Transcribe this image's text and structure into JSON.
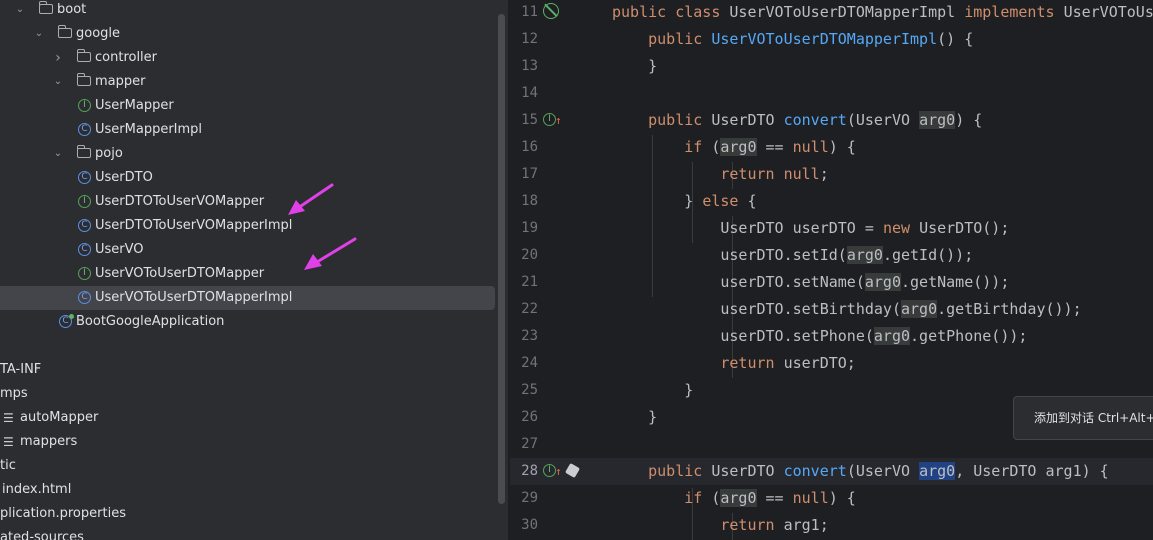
{
  "project_tree": {
    "rows": [
      {
        "label": "boot",
        "kind": "folder",
        "indent": 1,
        "expanded": true
      },
      {
        "label": "google",
        "kind": "folder",
        "indent": 2,
        "expanded": true
      },
      {
        "label": "controller",
        "kind": "folder",
        "indent": 3,
        "expanded": false
      },
      {
        "label": "mapper",
        "kind": "folder",
        "indent": 3,
        "expanded": true
      },
      {
        "label": "UserMapper",
        "kind": "interface",
        "indent": 4
      },
      {
        "label": "UserMapperImpl",
        "kind": "class",
        "indent": 4
      },
      {
        "label": "pojo",
        "kind": "folder",
        "indent": 3,
        "expanded": true
      },
      {
        "label": "UserDTO",
        "kind": "class",
        "indent": 4
      },
      {
        "label": "UserDTOToUserVOMapper",
        "kind": "interface",
        "indent": 4
      },
      {
        "label": "UserDTOToUserVOMapperImpl",
        "kind": "class",
        "indent": 4
      },
      {
        "label": "UserVO",
        "kind": "class",
        "indent": 4
      },
      {
        "label": "UserVOToUserDTOMapper",
        "kind": "interface",
        "indent": 4
      },
      {
        "label": "UserVOToUserDTOMapperImpl",
        "kind": "class",
        "indent": 4,
        "selected": true
      },
      {
        "label": "BootGoogleApplication",
        "kind": "app",
        "indent": 3
      },
      {
        "label": "",
        "kind": "spacer"
      },
      {
        "label": "TA-INF",
        "kind": "plain",
        "indent": 0
      },
      {
        "label": "mps",
        "kind": "plain",
        "indent": 0
      },
      {
        "label": "autoMapper",
        "kind": "lines",
        "indent": 0
      },
      {
        "label": "mappers",
        "kind": "lines",
        "indent": 0
      },
      {
        "label": "tic",
        "kind": "plain",
        "indent": 0
      },
      {
        "label": "index.html",
        "kind": "plain2",
        "indent": 0
      },
      {
        "label": "plication.properties",
        "kind": "plain",
        "indent": 0
      },
      {
        "label": "ated-sources",
        "kind": "plain",
        "indent": 0
      }
    ]
  },
  "editor": {
    "lines": [
      {
        "num": "11",
        "gutter": "bean",
        "tokens": [
          [
            "k",
            "public class "
          ],
          [
            "p",
            "UserVOToUserDTOMapperImpl "
          ],
          [
            "k",
            "implements "
          ],
          [
            "p",
            "UserVOToUserDTOMapper"
          ]
        ]
      },
      {
        "num": "12",
        "tokens": [
          [
            "p",
            "    "
          ],
          [
            "k",
            "public "
          ],
          [
            "f",
            "UserVOToUserDTOMapperImpl"
          ],
          [
            "p",
            "() {"
          ]
        ]
      },
      {
        "num": "13",
        "tokens": [
          [
            "p",
            "    }"
          ]
        ]
      },
      {
        "num": "14",
        "tokens": []
      },
      {
        "num": "15",
        "gutter": "impl",
        "tokens": [
          [
            "p",
            "    "
          ],
          [
            "k",
            "public "
          ],
          [
            "p",
            "UserDTO "
          ],
          [
            "f",
            "convert"
          ],
          [
            "p",
            "(UserVO "
          ],
          [
            "h",
            "arg0"
          ],
          [
            "p",
            ") {"
          ]
        ]
      },
      {
        "num": "16",
        "tokens": [
          [
            "p",
            "        "
          ],
          [
            "k",
            "if "
          ],
          [
            "p",
            "("
          ],
          [
            "h",
            "arg0"
          ],
          [
            "p",
            " == "
          ],
          [
            "k",
            "null"
          ],
          [
            "p",
            ") {"
          ]
        ]
      },
      {
        "num": "17",
        "tokens": [
          [
            "p",
            "            "
          ],
          [
            "k",
            "return null"
          ],
          [
            "p",
            ";"
          ]
        ]
      },
      {
        "num": "18",
        "tokens": [
          [
            "p",
            "        } "
          ],
          [
            "k",
            "else "
          ],
          [
            "p",
            "{"
          ]
        ]
      },
      {
        "num": "19",
        "tokens": [
          [
            "p",
            "            UserDTO userDTO = "
          ],
          [
            "k",
            "new "
          ],
          [
            "p",
            "UserDTO();"
          ]
        ]
      },
      {
        "num": "20",
        "tokens": [
          [
            "p",
            "            userDTO.setId("
          ],
          [
            "h",
            "arg0"
          ],
          [
            "p",
            ".getId());"
          ]
        ]
      },
      {
        "num": "21",
        "tokens": [
          [
            "p",
            "            userDTO.setName("
          ],
          [
            "h",
            "arg0"
          ],
          [
            "p",
            ".getName());"
          ]
        ]
      },
      {
        "num": "22",
        "tokens": [
          [
            "p",
            "            userDTO.setBirthday("
          ],
          [
            "h",
            "arg0"
          ],
          [
            "p",
            ".getBirthday());"
          ]
        ]
      },
      {
        "num": "23",
        "tokens": [
          [
            "p",
            "            userDTO.setPhone("
          ],
          [
            "h",
            "arg0"
          ],
          [
            "p",
            ".getPhone());"
          ]
        ]
      },
      {
        "num": "24",
        "tokens": [
          [
            "p",
            "            "
          ],
          [
            "k",
            "return "
          ],
          [
            "p",
            "userDTO;"
          ]
        ]
      },
      {
        "num": "25",
        "tokens": [
          [
            "p",
            "        }"
          ]
        ]
      },
      {
        "num": "26",
        "tokens": [
          [
            "p",
            "    }"
          ]
        ]
      },
      {
        "num": "27",
        "tokens": []
      },
      {
        "num": "28",
        "gutter": "impl2",
        "current": true,
        "tokens": [
          [
            "p",
            "    "
          ],
          [
            "k",
            "public "
          ],
          [
            "p",
            "UserDTO "
          ],
          [
            "f",
            "convert"
          ],
          [
            "p",
            "(UserVO "
          ],
          [
            "s",
            "arg0"
          ],
          [
            "p",
            ", UserDTO arg1) {"
          ]
        ]
      },
      {
        "num": "29",
        "tokens": [
          [
            "p",
            "        "
          ],
          [
            "k",
            "if "
          ],
          [
            "p",
            "("
          ],
          [
            "h",
            "arg0"
          ],
          [
            "p",
            " == "
          ],
          [
            "k",
            "null"
          ],
          [
            "p",
            ") {"
          ]
        ]
      },
      {
        "num": "30",
        "tokens": [
          [
            "p",
            "            "
          ],
          [
            "k",
            "return "
          ],
          [
            "p",
            "arg1;"
          ]
        ]
      }
    ]
  },
  "tooltip": {
    "text": "添加到对话 Ctrl+Alt+I"
  },
  "colors": {
    "annotation_arrow": "#e040e8",
    "keyword": "#cf8e6d",
    "function": "#56a8f5"
  }
}
